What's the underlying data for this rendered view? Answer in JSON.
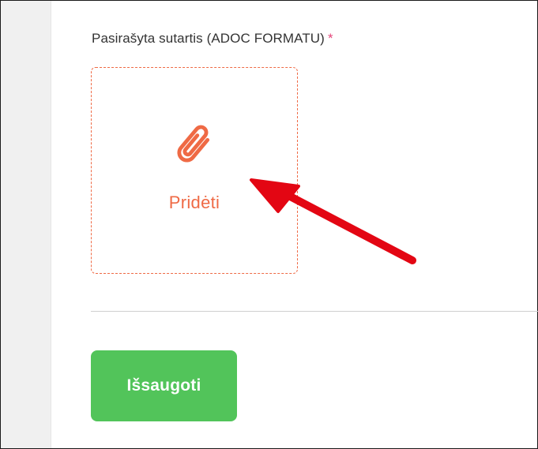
{
  "form": {
    "field_label": "Pasirašyta sutartis (ADOC FORMATU)",
    "required_marker": "*",
    "upload": {
      "label": "Pridėti",
      "icon": "paperclip-icon"
    },
    "save_label": "Išsaugoti"
  },
  "colors": {
    "accent": "#ef6a45",
    "required": "#e4467a",
    "save_button": "#52c45a",
    "annotation_arrow": "#e30613"
  }
}
